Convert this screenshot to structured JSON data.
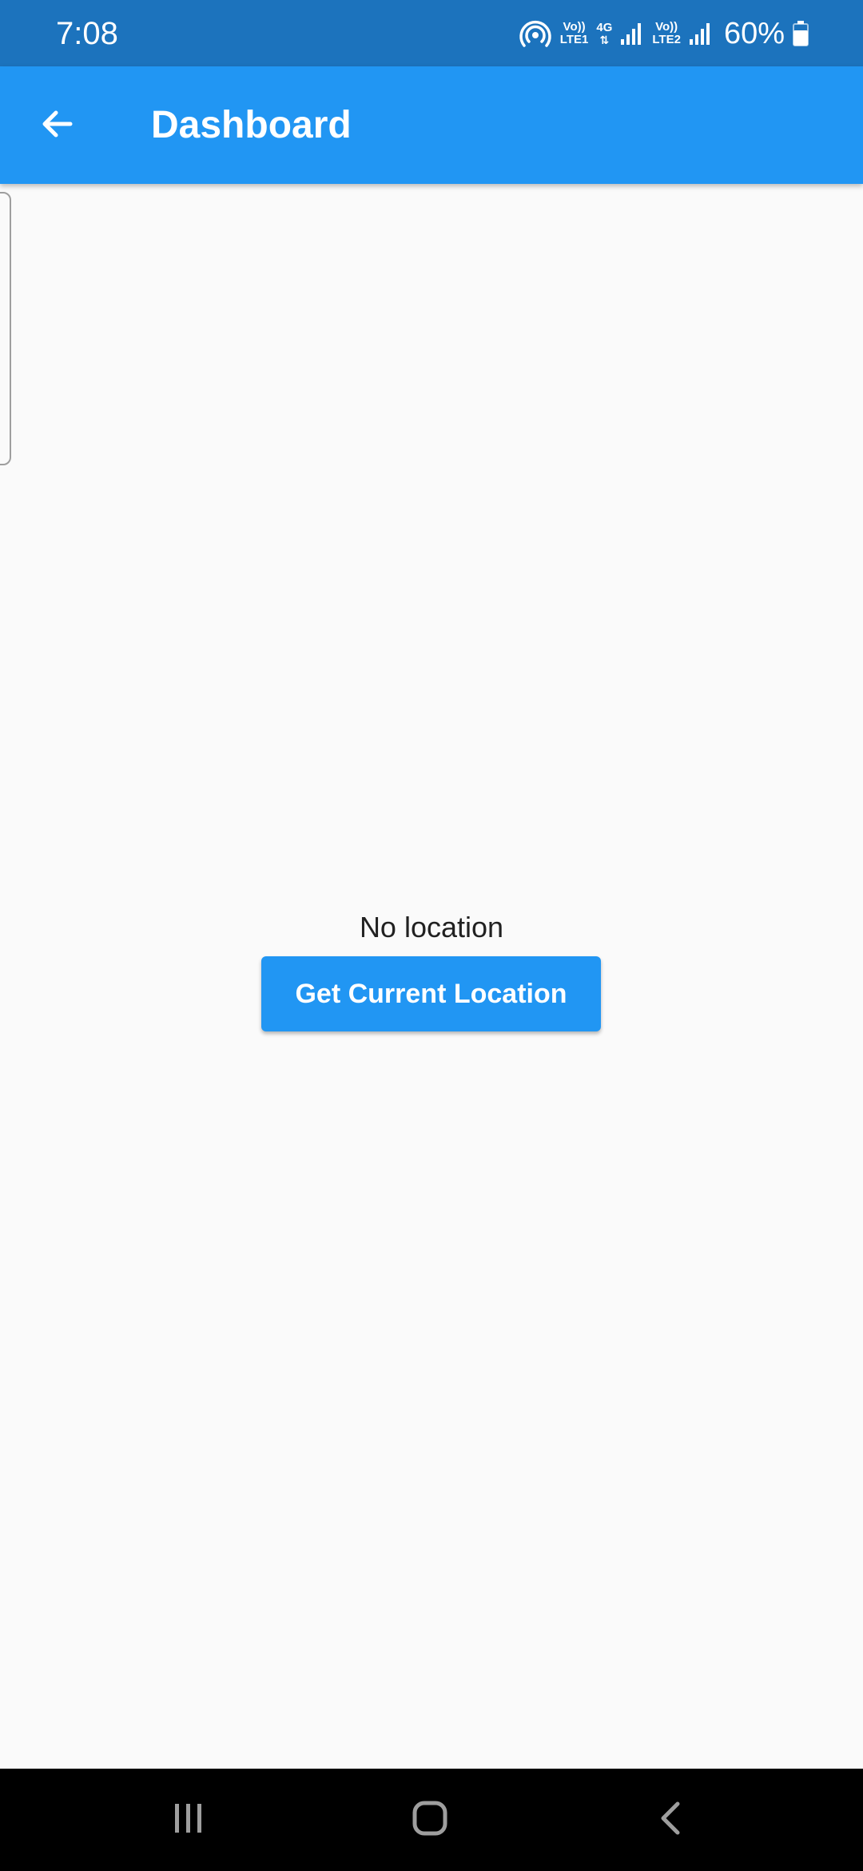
{
  "status_bar": {
    "time": "7:08",
    "sim1_label_top": "Vo))",
    "sim1_label_bottom": "LTE1",
    "net_type": "4G",
    "sim2_label_top": "Vo))",
    "sim2_label_bottom": "LTE2",
    "battery": "60%",
    "icons": [
      "hotspot-icon",
      "signal-icon",
      "battery-icon"
    ]
  },
  "app_bar": {
    "title": "Dashboard",
    "back_icon": "arrow-back-icon",
    "background": "#2196f3"
  },
  "main": {
    "location_status": "No location",
    "get_location_label": "Get Current Location"
  },
  "nav_bar": {
    "buttons": [
      "recent-apps-icon",
      "home-icon",
      "back-icon"
    ]
  },
  "colors": {
    "accent": "#2196f3",
    "status_bar": "#1c73bd",
    "background": "#fafafa"
  }
}
